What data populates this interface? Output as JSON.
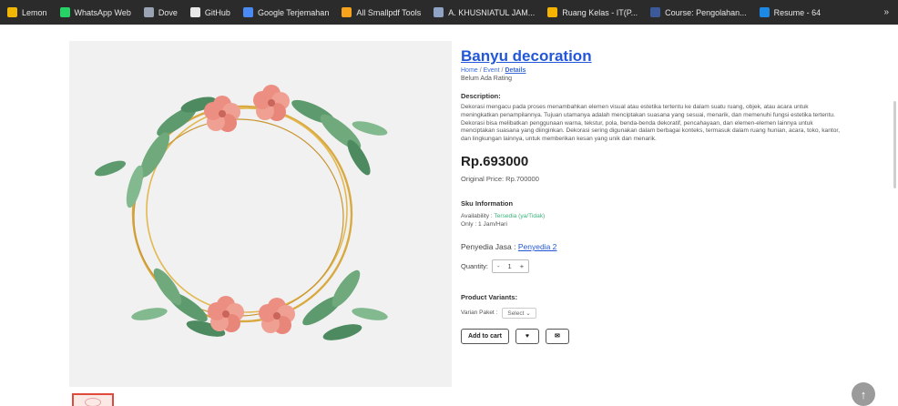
{
  "bookmarks": [
    {
      "label": "Lemon",
      "icon": "folder-icon",
      "color": "#f2b705"
    },
    {
      "label": "WhatsApp Web",
      "icon": "whatsapp-icon",
      "color": "#25d366"
    },
    {
      "label": "Dove",
      "icon": "globe-icon",
      "color": "#9aa4b5"
    },
    {
      "label": "GitHub",
      "icon": "github-icon",
      "color": "#e8e8e8"
    },
    {
      "label": "Google Terjemahan",
      "icon": "translate-icon",
      "color": "#4a8af4"
    },
    {
      "label": "All Smallpdf Tools",
      "icon": "smallpdf-icon",
      "color": "#f7a31c"
    },
    {
      "label": "A. KHUSNIATUL JAM...",
      "icon": "page-icon",
      "color": "#8fa3c4"
    },
    {
      "label": "Ruang Kelas - IT(P...",
      "icon": "classroom-icon",
      "color": "#f5b400"
    },
    {
      "label": "Course: Pengolahan...",
      "icon": "course-icon",
      "color": "#3c5a9a"
    },
    {
      "label": "Resume - 64",
      "icon": "resume-icon",
      "color": "#1e88e5"
    }
  ],
  "bookmarks_more": "»",
  "product": {
    "title": "Banyu decoration",
    "breadcrumb": [
      "Home",
      "Event",
      "Details"
    ],
    "rating": "Belum Ada Rating",
    "description_heading": "Description:",
    "description": "Dekorasi mengacu pada proses menambahkan elemen visual atau estetika tertentu ke dalam suatu ruang, objek, atau acara untuk meningkatkan penampilannya. Tujuan utamanya adalah menciptakan suasana yang sesuai, menarik, dan memenuhi fungsi estetika tertentu. Dekorasi bisa melibatkan penggunaan warna, tekstur, pola, benda-benda dekoratif, pencahayaan, dan elemen-elemen lainnya untuk menciptakan suasana yang diinginkan. Dekorasi sering digunakan dalam berbagai konteks, termasuk dalam ruang hunian, acara, toko, kantor, dan lingkungan lainnya, untuk memberikan kesan yang unik dan menarik.",
    "price": "Rp.693000",
    "original_price": "Original Price: Rp.700000",
    "sku_heading": "Sku Information",
    "availability_label": "Availability :",
    "availability_value": "Tersedia (ya/Tidak)",
    "only_label": "Only : 1 Jam/Hari",
    "vendor_label": "Penyedia Jasa :",
    "vendor_name": "Penyedia 2",
    "quantity_label": "Quantity:",
    "quantity_minus": "-",
    "quantity_value": "1",
    "quantity_plus": "+",
    "variants_heading": "Product Variants:",
    "variant_label": "Varian Paket :",
    "variant_selected": "Select",
    "add_to_cart": "Add to cart",
    "wishlist_icon": "heart-icon",
    "message_icon": "envelope-icon"
  },
  "colors": {
    "accent": "#2157d8",
    "available": "#3bb37a",
    "leaf": "#5d9b6e",
    "flower": "#ec8f82",
    "ring": "#d9a941"
  }
}
